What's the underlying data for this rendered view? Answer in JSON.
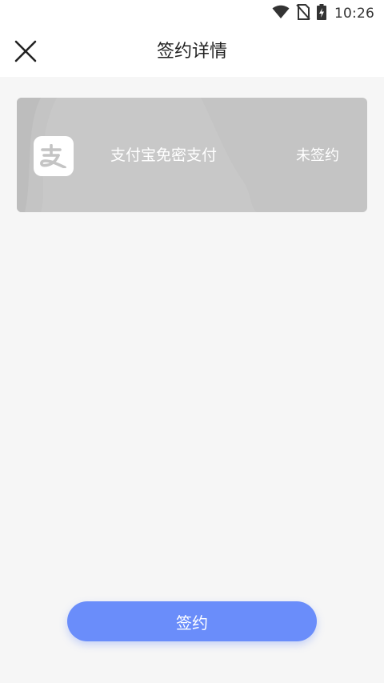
{
  "status_bar": {
    "time": "10:26",
    "icons": [
      "wifi-icon",
      "no-sim-icon",
      "battery-charging-icon"
    ]
  },
  "header": {
    "title": "签约详情",
    "close_icon": "close-icon"
  },
  "card": {
    "logo_icon": "alipay-logo-icon",
    "service_name": "支付宝免密支付",
    "status": "未签约"
  },
  "action": {
    "sign_label": "签约"
  },
  "colors": {
    "card_bg": "#c4c4c4",
    "button_bg": "#6a8dfa",
    "page_bg": "#f6f6f6"
  }
}
